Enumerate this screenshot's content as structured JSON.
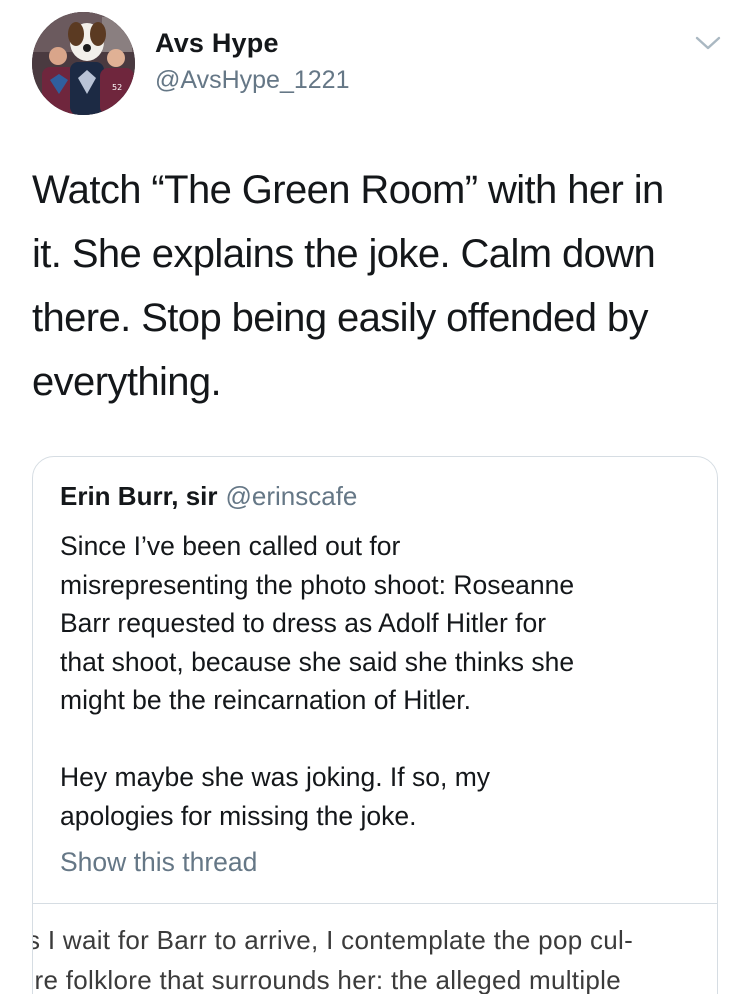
{
  "tweet": {
    "author_name": "Avs Hype",
    "author_handle": "@AvsHype_1221",
    "text_lines": [
      "Watch “The Green Room” with her in",
      "it. She explains the joke. Calm down",
      "there. Stop being easily offended by",
      "everything."
    ]
  },
  "quoted_tweet": {
    "author_name": "Erin Burr, sir",
    "author_handle": "@erinscafe",
    "paragraph1_lines": [
      "Since I’ve been called out for",
      "misrepresenting the photo shoot: Roseanne",
      "Barr requested to dress as Adolf Hitler for",
      "that shoot, because she said she thinks she",
      "might be the reincarnation of Hitler."
    ],
    "paragraph2_lines": [
      "Hey maybe she was joking. If so, my",
      "apologies for missing the joke."
    ],
    "show_thread_label": "Show this thread",
    "embedded_image_lines": [
      "s I wait for Barr to arrive, I contemplate the pop cul-",
      "ıre folklore that surrounds her: the alleged multiple"
    ]
  },
  "icons": {
    "menu": "chevron-down-icon"
  },
  "colors": {
    "primary_text": "#14171a",
    "secondary_text": "#657786",
    "card_border": "#d6dde3"
  }
}
